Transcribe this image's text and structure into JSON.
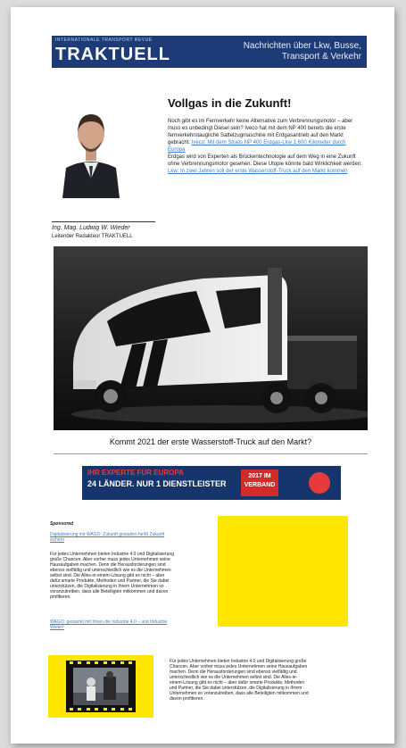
{
  "header": {
    "brand_super": "INTERNATIONALE TRANSPORT REVUE",
    "brand_logo": "TRAKTUELL",
    "tagline": "Nachrichten über Lkw, Busse, Transport & Verkehr",
    "colors": {
      "bar": "#1d3b76",
      "link": "#3a7fcf"
    }
  },
  "author": {
    "name": "Ing. Mag. Ludwig W. Wieder",
    "role": "Leitender Redakteur TRAKTUELL"
  },
  "article": {
    "headline": "Vollgas in die Zukunft!",
    "p1": "Noch gibt es im Fernverkehr keine Alternative zum Verbrennungsmotor – aber muss es unbedingt Diesel sein? Iveco hat mit dem NP 400 bereits die erste fernverkehrstaugliche Sattelzugmaschine mit Erdgasantrieb auf den Markt gebracht:",
    "p1_link": "Iveco: Mit dem Stralis NP 400 Erdgas-Lkw 1.600 Kilometer durch Europa",
    "p2": "Erdgas wird von Experten als Brückentechnologie auf dem Weg in eine Zukunft ohne Verbrennungsmotor gesehen. Diese Utopie könnte bald Wirklichkeit werden:",
    "p2_link": "Lkw: In zwei Jahren soll der erste Wasserstoff-Truck auf den Markt kommen"
  },
  "feature": {
    "caption": "Kommt 2021 der erste Wasserstoff-Truck auf den Markt?"
  },
  "ad": {
    "line1": "IHR EXPERTE FÜR EUROPA",
    "line2": "24 LÄNDER. NUR 1 DIENSTLEISTER",
    "badge": "2017 IM VERBAND"
  },
  "sponsored": {
    "label": "Sponsored",
    "link": "Digitalisierung mit WAGO: Zukunft gestalten heißt Zukunft sichern",
    "body": "Für jedes Unternehmen bieten Industrie 4.0 und Digitalisierung große Chancen. Aber vorher muss jedes Unternehmen seine Hausaufgaben machen. Denn die Herausforderungen sind ebenso vielfältig und unterschiedlich wie es die Unternehmen selbst sind. Die Alles-in-einem-Lösung gibt es nicht – aber dafür smarte Produkte, Methoden und Partner, die Sie dabei unterstützen, die Digitalisierung in Ihrem Unternehmen so voranzutreiben, dass alle Beteiligten mitkommen und davon profitieren.",
    "link2": "WAGO: gestartet mit Ihnen die Industrie 4.0 – und Industrie Weiter!"
  },
  "bottom": {
    "body": "Für jedes Unternehmen bieten Industrie 4.0 und Digitalisierung große Chancen. Aber vorher muss jedes Unternehmen seine Hausaufgaben machen. Denn die Herausforderungen sind ebenso vielfältig und unterschiedlich wie es die Unternehmen selbst sind. Die Alles-in-einem-Lösung gibt es nicht – aber dafür smarte Produkte, Methoden und Partner, die Sie dabei unterstützen, die Digitalisierung in Ihrem Unternehmen so voranzutreiben, dass alle Beteiligten mitkommen und davon profitieren."
  }
}
